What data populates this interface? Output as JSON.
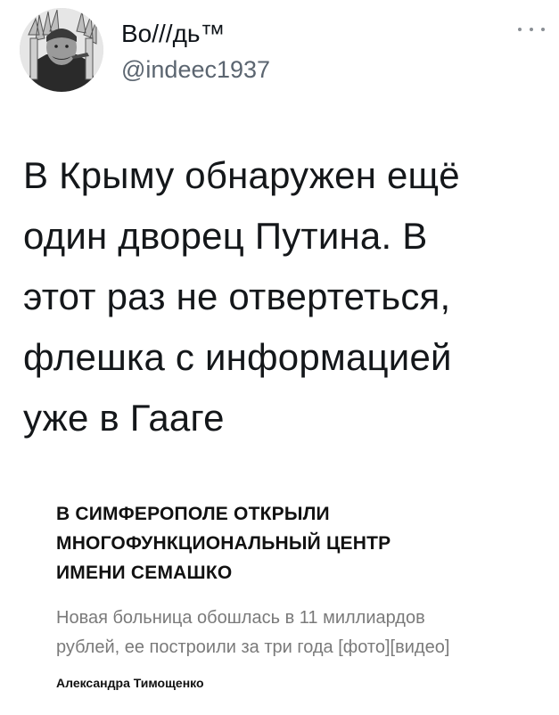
{
  "tweet": {
    "author_name": "Во///дь™",
    "author_handle": "@indeec1937",
    "text_lines": [
      "В Крыму обнаружен ещё",
      "один дворец Путина. В",
      "этот раз не отвертеться,",
      "флешка с информацией",
      "уже в Гааге"
    ]
  },
  "article": {
    "title_lines": [
      "В СИМФЕРОПОЛЕ ОТКРЫЛИ",
      "МНОГОФУНКЦИОНАЛЬНЫЙ ЦЕНТР",
      "ИМЕНИ СЕМАШКО"
    ],
    "lead_lines": [
      "Новая больница обошлась в 11 миллиардов",
      "рублей, ее построили за три года [фото][видео]"
    ],
    "author": "Александра Тимощенко"
  },
  "icons": {
    "more": "more-horizontal-icon",
    "avatar": "avatar-portrait"
  },
  "colors": {
    "text": "#0f1419",
    "handle": "#5b6570",
    "lead": "#7a7a7a"
  }
}
